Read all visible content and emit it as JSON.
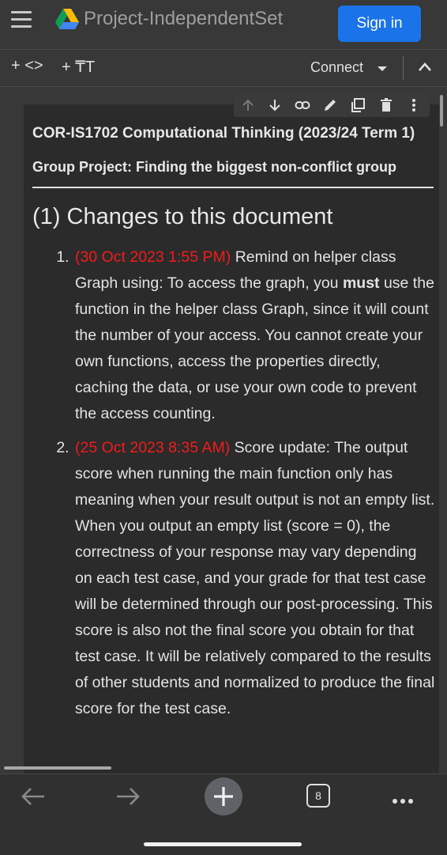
{
  "header": {
    "title": "Project-IndependentSet",
    "sign_in_label": "Sign in"
  },
  "toolbar": {
    "add_code_label": "+ <>",
    "add_text_label": "+ ₸T",
    "connect_label": "Connect"
  },
  "cell_toolbar_icons": [
    "arrow-up-icon",
    "arrow-down-icon",
    "link-icon",
    "pencil-icon",
    "mirror-cell-icon",
    "trash-icon",
    "more-vert-icon"
  ],
  "document": {
    "course_title": "COR-IS1702 Computational Thinking (2023/24 Term 1)",
    "project_title": "Group Project: Finding the biggest non-conflict group",
    "section_heading": "(1) Changes to this document",
    "changes": [
      {
        "timestamp": "(30 Oct 2023 1:55 PM)",
        "text_before": " Remind on helper class Graph using: To access the graph, you ",
        "bold": "must",
        "text_after": " use the function in the helper class Graph, since it will count the number of your access. You cannot create your own functions, access the properties directly, caching the data, or use your own code to prevent the access counting."
      },
      {
        "timestamp": "(25 Oct 2023 8:35 AM)",
        "text": " Score update: The output score when running the main function only has meaning when your result output is not an empty list. When you output an empty list (score = 0), the correctness of your response may vary depending on each test case, and your grade for that test case will be determined through our post-processing. This score is also not the final score you obtain for that test case. It will be relatively compared to the results of other students and normalized to produce the final score for the test case."
      }
    ]
  },
  "bottom_nav": {
    "tab_count": "8"
  },
  "colors": {
    "accent": "#1a73e8",
    "timestamp": "#f21b1b",
    "background": "#383838",
    "cell_background": "#2b2b2b"
  }
}
